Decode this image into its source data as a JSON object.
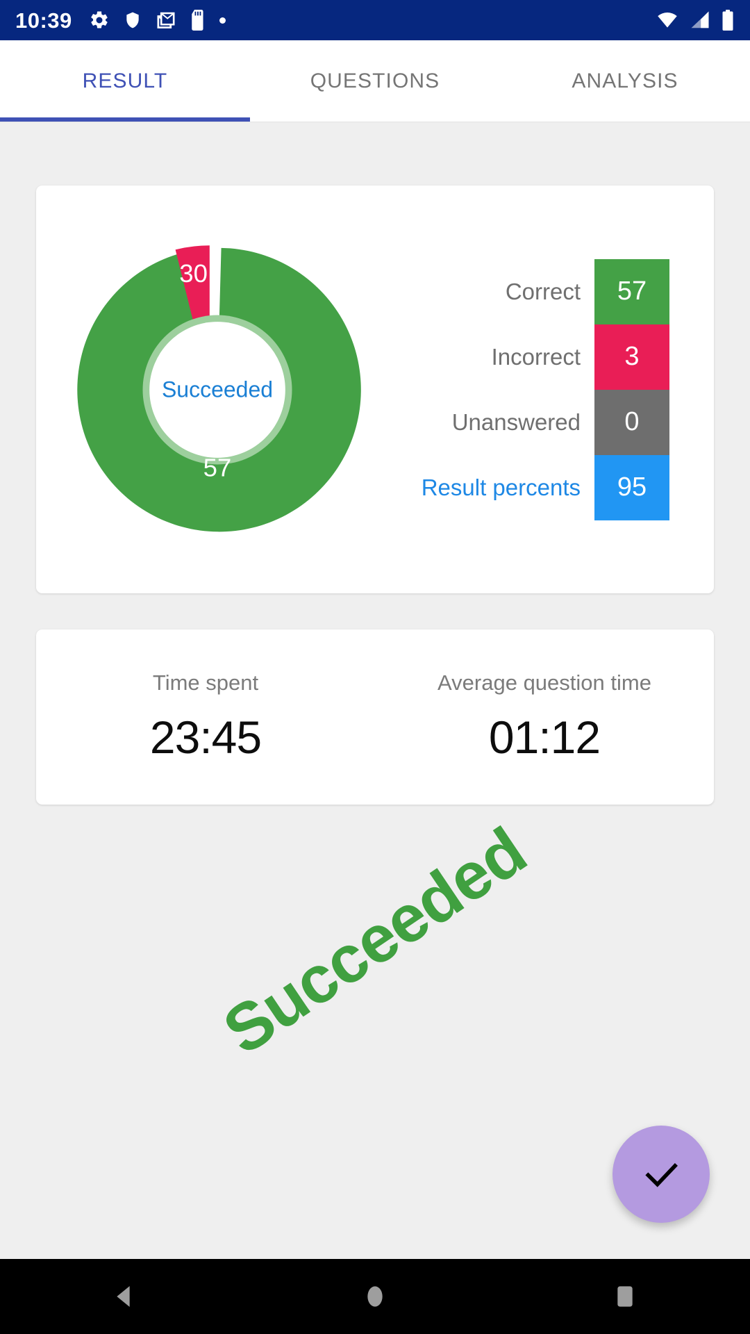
{
  "status_bar": {
    "time": "10:39",
    "left_icons": [
      "gear-icon",
      "shield-icon",
      "gmail-icon",
      "sd-card-icon",
      "dot-icon"
    ],
    "right_icons": [
      "wifi-icon",
      "cellular-signal-icon",
      "battery-icon"
    ],
    "background_color": "#06277f"
  },
  "tabs": {
    "items": [
      {
        "label": "RESULT",
        "active": true
      },
      {
        "label": "QUESTIONS",
        "active": false
      },
      {
        "label": "ANALYSIS",
        "active": false
      }
    ],
    "active_color": "#3f51b5",
    "inactive_color": "#757575"
  },
  "summary": {
    "center_label": "Succeeded",
    "legend": [
      {
        "label": "Correct",
        "value": "57",
        "color": "#44a146",
        "accent": false
      },
      {
        "label": "Incorrect",
        "value": "3",
        "color": "#e91e56",
        "accent": false
      },
      {
        "label": "Unanswered",
        "value": "0",
        "color": "#6e6e6e",
        "accent": false
      },
      {
        "label": "Result percents",
        "value": "95",
        "color": "#2196f3",
        "accent": true
      }
    ]
  },
  "chart_data": {
    "type": "pie",
    "title": "",
    "center_text": "Succeeded",
    "labels": [
      "Correct",
      "Incorrect",
      "Unanswered"
    ],
    "values": [
      57,
      3,
      0
    ],
    "colors": [
      "#44a146",
      "#e91e56",
      "#6e6e6e"
    ],
    "slice_labels": [
      "57",
      "30"
    ],
    "legend_position": "right",
    "donut": true,
    "inner_radius_ratio": 0.52,
    "exploded_slices": [
      "Incorrect"
    ],
    "grid": false
  },
  "time_card": {
    "columns": [
      {
        "label": "Time spent",
        "value": "23:45"
      },
      {
        "label": "Average question time",
        "value": "01:12"
      }
    ]
  },
  "watermark": {
    "text": "Succeeded",
    "color": "#40a040",
    "rotation_deg": -34
  },
  "fab": {
    "icon": "check-icon",
    "color": "#b49ae0"
  },
  "nav_bar": {
    "buttons": [
      "back-icon",
      "home-icon",
      "recents-icon"
    ],
    "icon_color": "#9e9e9e"
  }
}
